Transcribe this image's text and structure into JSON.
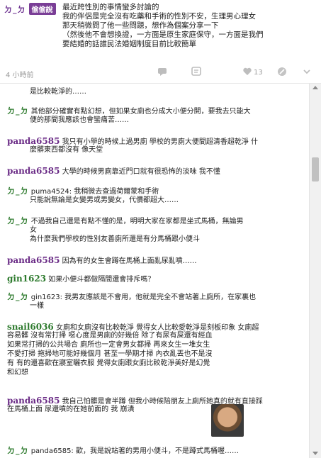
{
  "post": {
    "user_mark": "ㄉ_ㄉ",
    "badge": "偷偷說",
    "lines": [
      "最近跨性別的事情蠻多討論的",
      "我的伴侶是完全沒有吃藥和手術的性別不安，生理男心理女",
      "那天稍微問了他一些問題，想作為個案分享一下",
      "（然後他不會想換證，一方面是原生家庭保守，一方面是我們",
      "要結婚的話誰民法婚姻制度目前比較簡單"
    ],
    "time": "4 小時前",
    "like_count": "13",
    "icons": [
      "chat-icon",
      "comment-icon",
      "heart-icon",
      "report-icon",
      "more-icon"
    ]
  },
  "comments": [
    {
      "kind": "cont",
      "text": "是比較乾淨的……"
    },
    {
      "kind": "dd",
      "mark": "ㄉ_ㄉ",
      "lines": [
        "其他部分確實有點幻想，但如果女廁也分成大小便分開，要我去只能大",
        "便的那間我應該也會蠻痛苦……"
      ]
    },
    {
      "kind": "name",
      "color": "p",
      "name": "panda6585",
      "lines": [
        "我只有小學的時候上過男廁 學校的男廁大便間超清香超乾淨 什",
        "麼髒東西都沒有 像天堂"
      ]
    },
    {
      "kind": "name",
      "color": "p",
      "name": "panda6585",
      "lines": [
        "大學的時候男廁靠近門口就有很恐怖的淡味 我不懂"
      ]
    },
    {
      "kind": "dd",
      "mark": "ㄉ_ㄉ",
      "lines": [
        "puma4524: 我稍微去查過荷爾蒙和手術",
        "只能說無論是女變男或男變女，代價都超大……"
      ]
    },
    {
      "kind": "dd",
      "mark": "ㄉ_ㄉ",
      "lines": [
        "不過我自己還是有點不懂的是，明明大家在家都是坐式馬桶，無論男",
        "女",
        "為什麼我們學校的性別友善廁所還是有分馬桶跟小便斗"
      ]
    },
    {
      "kind": "name",
      "color": "p",
      "name": "panda6585",
      "lines": [
        "因為有的女生會蹲在馬桶上面亂尿亂噴……"
      ]
    },
    {
      "kind": "name",
      "color": "g",
      "name": "gin1623",
      "lines": [
        "如果小便斗都做隔間還會排斥嗎？"
      ]
    },
    {
      "kind": "dd",
      "mark": "ㄉ_ㄉ",
      "lines": [
        "gin1623: 我男友應該是不會用，他就是完全不會站著上廁所，在家裏也",
        "一樣"
      ]
    },
    {
      "kind": "name",
      "color": "g",
      "name": "snail6036",
      "lines": [
        "女廁和女廁沒有比較乾淨 覺得女人比較愛乾淨是刻板印象 女廁超",
        "容易髒 沒有常打掃 噁心度是男廁的好幾倍 除了有尿有屎還有經血",
        "如果常打掃的公共場合 廁所也一定會男女都掃 再來女生一堆女生",
        "不愛打掃 拖掃地可能好幾個月 甚至一學期才掃 內衣亂丟也不是沒",
        "有 有的還喜歡在寢室曬衣服 覺得女廁跟女廁比較乾淨美好是幻覺",
        "和幻想"
      ]
    },
    {
      "kind": "name",
      "color": "p",
      "name": "panda6585",
      "lines": [
        "我自己怕髒是會半蹲 但我小時候陪朋友上廁所她真的就有直接踩",
        "在馬桶上面 尿還噴的在她前面的 我 崩潰"
      ]
    },
    {
      "kind": "dd",
      "mark": "ㄉ_ㄉ",
      "lines": [
        "panda6585: 歡，我是說站著的男用小便斗，不是蹲式馬桶喔……"
      ]
    }
  ]
}
